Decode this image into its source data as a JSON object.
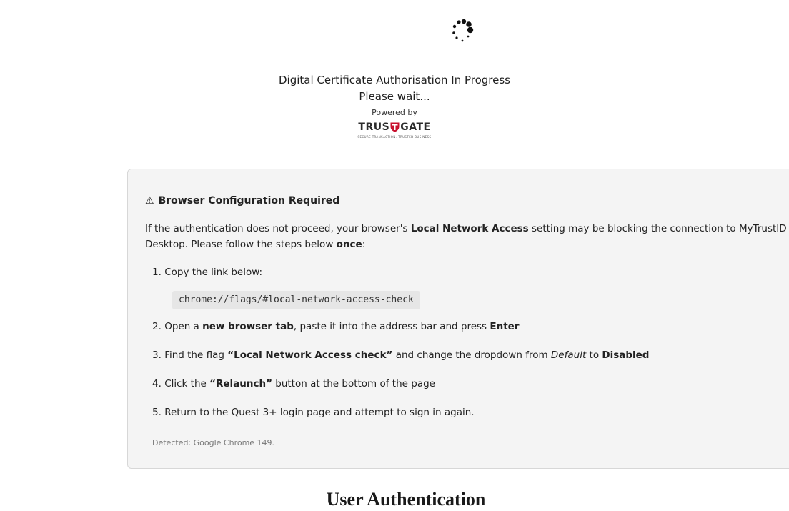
{
  "status": {
    "line1": "Digital Certificate Authorisation In Progress",
    "line2": "Please wait...",
    "powered_by": "Powered by"
  },
  "logo": {
    "word_left": "TRUS",
    "word_right": "GATE",
    "tagline": "SECURE TRANSACTION. TRUSTED BUSINESS",
    "accent_color": "#c8102e"
  },
  "notice": {
    "icon": "warning-icon",
    "icon_glyph": "⚠",
    "title": "Browser Configuration Required",
    "intro": {
      "part1": "If the authentication does not proceed, your browser's ",
      "bold1": "Local Network Access",
      "part2": " setting may be blocking the connection to MyTrustID Desktop. Please follow the steps below ",
      "bold2": "once",
      "part3": ":"
    },
    "steps": [
      {
        "number": "1.",
        "text": "Copy the link below:"
      },
      {
        "number": "2.",
        "part1": "Open a ",
        "bold1": "new browser tab",
        "part2": ", paste it into the address bar and press ",
        "bold2": "Enter"
      },
      {
        "number": "3.",
        "part1": "Find the flag ",
        "bold1": "“Local Network Access check”",
        "part2": " and change the dropdown from ",
        "italic": "Default",
        "part3": " to ",
        "bold2": "Disabled"
      },
      {
        "number": "4.",
        "part1": "Click the ",
        "bold1": "“Relaunch”",
        "part2": " button at the bottom of the page"
      },
      {
        "number": "5.",
        "text": "Return to the Quest 3+ login page and attempt to sign in again."
      }
    ],
    "flag_url": "chrome://flags/#local-network-access-check",
    "detected": "Detected: Google Chrome 149."
  },
  "heading": "User Authentication"
}
